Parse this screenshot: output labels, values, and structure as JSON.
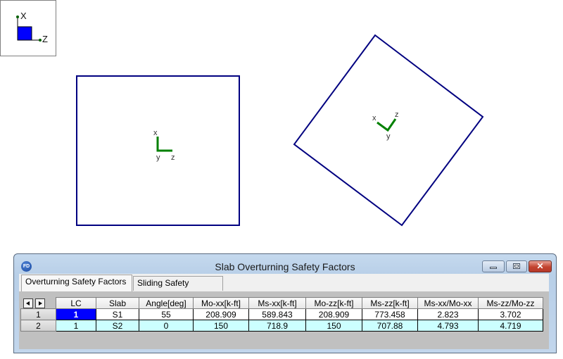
{
  "viewport": {
    "mini_axis": {
      "x_label": "X",
      "z_label": "Z"
    },
    "slabs": [
      {
        "name": "S1",
        "rotation_deg": 55,
        "local_axes": {
          "x": "x",
          "y": "y",
          "z": "z"
        }
      },
      {
        "name": "S2",
        "rotation_deg": 0,
        "local_axes": {
          "x": "x",
          "y": "y",
          "z": "z"
        }
      }
    ],
    "colors": {
      "outline": "#000080",
      "local_axis": "#008000",
      "mini_box": "#0000ff"
    }
  },
  "dialog": {
    "icon_text": "FD",
    "title": "Slab Overturning Safety Factors",
    "tabs": [
      {
        "label": "Overturning Safety Factors",
        "active": true
      },
      {
        "label": "Sliding Safety Factors",
        "active": false
      }
    ],
    "table": {
      "columns": [
        "LC",
        "Slab",
        "Angle[deg]",
        "Mo-xx[k-ft]",
        "Ms-xx[k-ft]",
        "Mo-zz[k-ft]",
        "Ms-zz[k-ft]",
        "Ms-xx/Mo-xx",
        "Ms-zz/Mo-zz"
      ],
      "rows": [
        {
          "index": "1",
          "cells": [
            "1",
            "S1",
            "55",
            "208.909",
            "589.843",
            "208.909",
            "773.458",
            "2.823",
            "3.702"
          ]
        },
        {
          "index": "2",
          "cells": [
            "1",
            "S2",
            "0",
            "150",
            "718.9",
            "150",
            "707.88",
            "4.793",
            "4.719"
          ]
        }
      ],
      "selected_cell": {
        "row": 0,
        "col": 0
      }
    }
  }
}
